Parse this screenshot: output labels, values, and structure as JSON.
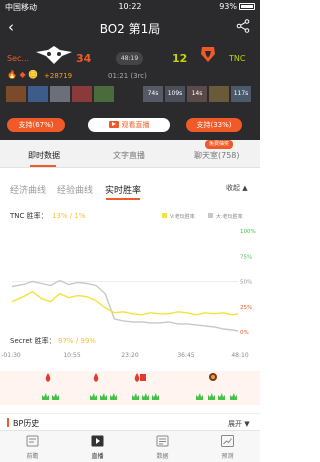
{
  "status_bar": {
    "carrier": "中国移动",
    "time": "10:22",
    "battery": "93%"
  },
  "header": {
    "title": "BO2   第1局"
  },
  "teams": {
    "left": {
      "name": "Sec...",
      "score": "34",
      "color": "#f05a28"
    },
    "right": {
      "name": "TNC",
      "score": "12",
      "color": "#c6d300"
    },
    "map_label": "48:19"
  },
  "game": {
    "gold_diff": "+28719",
    "time": "01:21 (3rc)"
  },
  "heroes": {
    "left": [
      {
        "name": "hero-1",
        "label": ""
      },
      {
        "name": "hero-2",
        "label": ""
      },
      {
        "name": "hero-3",
        "label": ""
      },
      {
        "name": "hero-4",
        "label": ""
      },
      {
        "name": "hero-5",
        "label": ""
      }
    ],
    "right": [
      {
        "name": "hero-6",
        "label": "74s"
      },
      {
        "name": "hero-7",
        "label": "109s"
      },
      {
        "name": "hero-8",
        "label": "14s"
      },
      {
        "name": "hero-9",
        "label": ""
      },
      {
        "name": "hero-10",
        "label": "117s"
      }
    ]
  },
  "support": {
    "left": "支持(67%)",
    "right": "支持(33%)",
    "watch": "观看直播"
  },
  "tabs": {
    "items": [
      "即时数据",
      "文字直播",
      "聊天室(758)"
    ],
    "active": 0,
    "badge": "免费抽奖"
  },
  "subtabs": {
    "items": [
      "经济曲线",
      "经验曲线",
      "实时胜率"
    ],
    "active": 2,
    "collapse": "收起 ▲"
  },
  "legend": {
    "series_a": "V:老玩胜率",
    "series_b": "大:老玩胜率"
  },
  "colors": {
    "accent": "#f05a28",
    "tnc": "#c6d300",
    "yellow": "#f5e23a",
    "green": "#46c24a",
    "grey": "#c8c8c8"
  },
  "chart_data": {
    "type": "line",
    "tnc_label": "TNC 胜率：",
    "tnc_value": "13% / 1%",
    "secret_label": "Secret 胜率：",
    "secret_value": "87% / 99%",
    "y_ticks": [
      "100%",
      "75%",
      "50%",
      "25%",
      "0%"
    ],
    "x_ticks": [
      "-01:30",
      "10:55",
      "23:20",
      "36:45",
      "48:10"
    ],
    "ylim": [
      0,
      100
    ],
    "x": [
      -1.5,
      1,
      3,
      5,
      7,
      9,
      11,
      13,
      15,
      17,
      19,
      21,
      23,
      25,
      27,
      29,
      31,
      33,
      35,
      37,
      39,
      41,
      43,
      45,
      47,
      48.2
    ],
    "series": [
      {
        "name": "V:老玩胜率",
        "color": "#f5e23a",
        "values": [
          30,
          35,
          40,
          33,
          30,
          38,
          34,
          36,
          35,
          31,
          24,
          19,
          20,
          18,
          17,
          19,
          18,
          18,
          20,
          19,
          17,
          19,
          18,
          19,
          17,
          18
        ]
      },
      {
        "name": "大:老玩胜率",
        "color": "#c8c8c8",
        "values": [
          45,
          47,
          50,
          48,
          46,
          51,
          47,
          49,
          48,
          46,
          38,
          13,
          11,
          10,
          10,
          9,
          9,
          10,
          8,
          8,
          7,
          6,
          5,
          3,
          2,
          1
        ]
      }
    ]
  },
  "events_row": {
    "markers": [
      "kill",
      "tower",
      "rosh"
    ]
  },
  "bp": {
    "title": "BP历史",
    "expand": "展开 ▼"
  },
  "bottom_nav": {
    "items": [
      "前瞻",
      "直播",
      "数据",
      "预测"
    ],
    "active": 1
  }
}
